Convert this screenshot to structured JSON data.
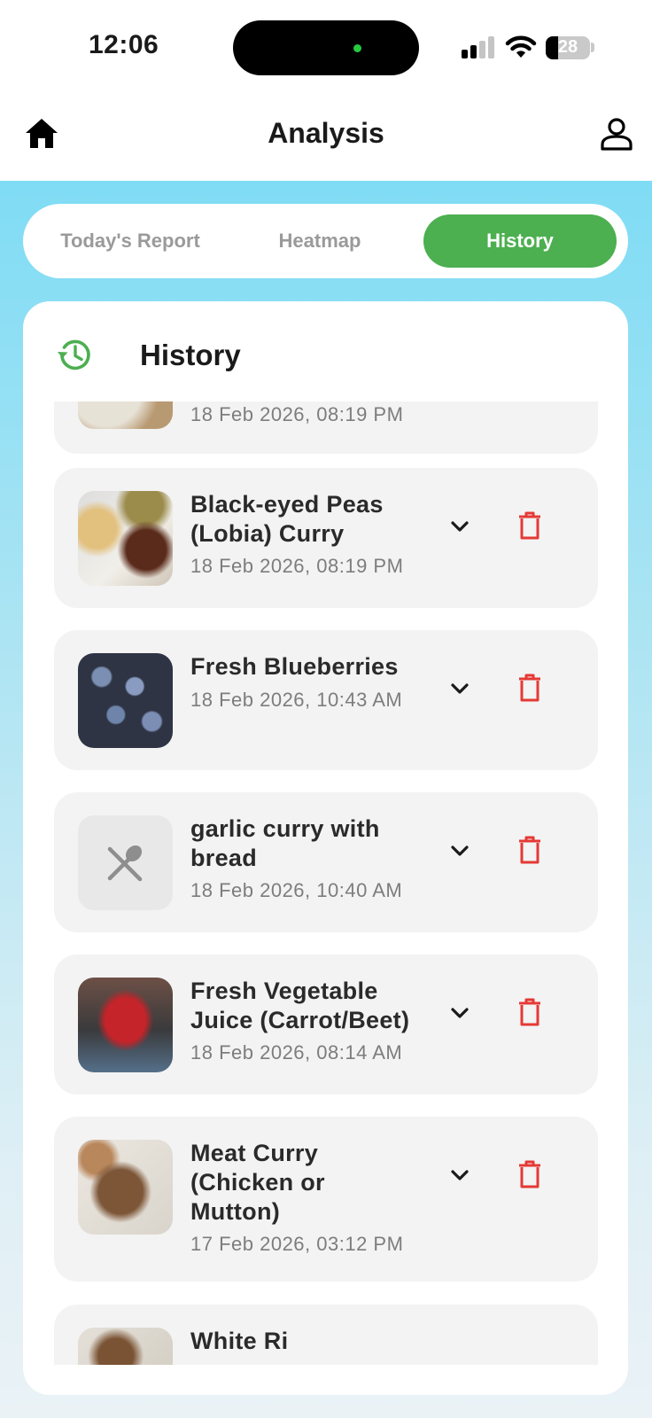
{
  "status_bar": {
    "time": "12:06",
    "battery": "28"
  },
  "header": {
    "title": "Analysis"
  },
  "tabs": [
    {
      "label": "Today's Report",
      "active": false
    },
    {
      "label": "Heatmap",
      "active": false
    },
    {
      "label": "History",
      "active": true
    }
  ],
  "card": {
    "title": "History"
  },
  "history": [
    {
      "name": "",
      "date": "18 Feb 2026, 08:19 PM",
      "thumb": "rice-lentils-photo"
    },
    {
      "name": "Black-eyed Peas (Lobia) Curry",
      "date": "18 Feb 2026, 08:19 PM",
      "thumb": "lobia-curry-photo"
    },
    {
      "name": "Fresh Blueberries",
      "date": "18 Feb 2026, 10:43 AM",
      "thumb": "blueberries-photo"
    },
    {
      "name": "garlic curry with bread",
      "date": "18 Feb 2026, 10:40 AM",
      "thumb": "placeholder-utensils-icon"
    },
    {
      "name": "Fresh Vegetable Juice (Carrot/Beet)",
      "date": "18 Feb 2026, 08:14 AM",
      "thumb": "juice-blender-photo"
    },
    {
      "name": "Meat Curry (Chicken or Mutton)",
      "date": "17 Feb 2026, 03:12 PM",
      "thumb": "meat-curry-photo"
    },
    {
      "name": "White Ri",
      "date": "",
      "thumb": "rice-photo"
    }
  ],
  "colors": {
    "accent": "#4caf50",
    "delete": "#e53935",
    "item_bg": "#f3f3f3"
  }
}
